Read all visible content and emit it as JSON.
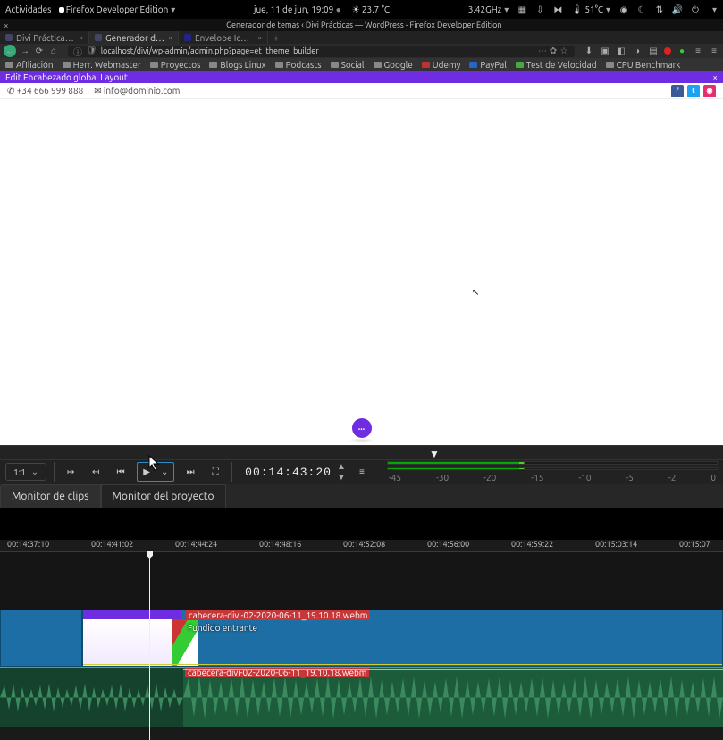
{
  "gnome": {
    "activities": "Actividades",
    "app_menu": "Firefox Developer Edition",
    "datetime": "jue, 11 de jun, 19:09",
    "weather": "23.7 °C",
    "cpu_freq": "3.42GHz",
    "temp2": "51°C"
  },
  "window_title": "Generador de temas ‹ Divi Prácticas — WordPress - Firefox Developer Edition",
  "tabs": [
    {
      "label": "Divi Prácticas | Otro sitio re…",
      "active": false
    },
    {
      "label": "Generador de temas ‹ Div…",
      "active": true
    },
    {
      "label": "Envelope Icon | Font Aw…",
      "active": false
    }
  ],
  "address": "localhost/divi/wp-admin/admin.php?page=et_theme_builder",
  "bookmarks": [
    "Afiliación",
    "Herr. Webmaster",
    "Proyectos",
    "Blogs Linux",
    "Podcasts",
    "Social",
    "Google",
    "Udemy",
    "PayPal",
    "Test de Velocidad",
    "CPU Benchmark"
  ],
  "divi_bar": {
    "label": "Edit Encabezado global Layout"
  },
  "contact": {
    "phone": "+34 666 999 888",
    "email": "info@dominio.com"
  },
  "divi_fab": "···",
  "editor": {
    "zoom": "1:1",
    "timecode": "00:14:43:20",
    "meter_scale": [
      "-45",
      "-30",
      "-20",
      "-15",
      "-10",
      "-5",
      "-2",
      "0"
    ],
    "monitor_tabs": [
      "Monitor de clips",
      "Monitor del proyecto"
    ],
    "active_monitor_tab": 1,
    "timeline_labels": [
      "00:14:37:10",
      "00:14:41:02",
      "00:14:44:24",
      "00:14:48:16",
      "00:14:52:08",
      "00:14:56:00",
      "00:14:59:22",
      "00:15:03:14",
      "00:15:07"
    ],
    "clip_name": "cabecera-divi-02-2020-06-11_19.10.18.webm",
    "clip_effect": "Fundido entrante"
  }
}
